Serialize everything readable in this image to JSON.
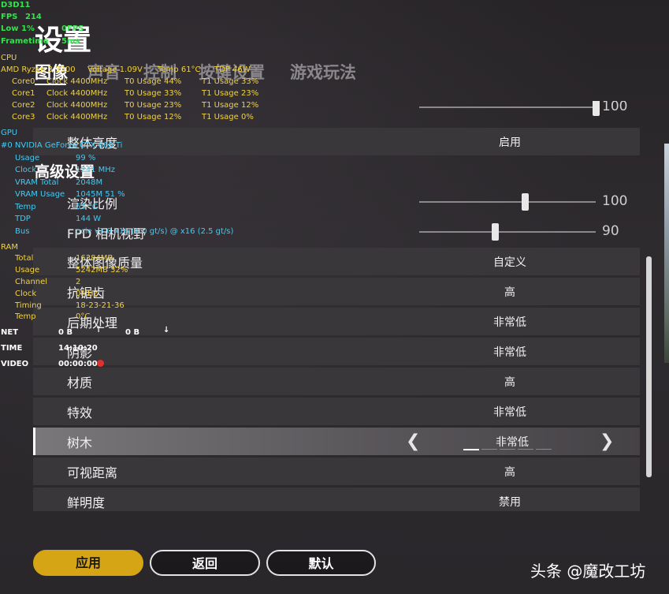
{
  "page": {
    "title": "设置"
  },
  "tabs": [
    {
      "label": "图像",
      "active": true
    },
    {
      "label": "声音"
    },
    {
      "label": "控制"
    },
    {
      "label": "按键设置"
    },
    {
      "label": "游戏玩法"
    }
  ],
  "partial_top_slider": {
    "value": "100"
  },
  "rows_top": [
    {
      "label": "整体亮度",
      "value": "启用"
    }
  ],
  "advanced": {
    "title": "高级设置",
    "sliders": [
      {
        "label": "渲染比例",
        "value": "100",
        "fraction": 0.6
      },
      {
        "label": "FPD 相机视野",
        "value": "90",
        "fraction": 0.43
      }
    ],
    "rows": [
      {
        "label": "整体图像质量",
        "value": "自定义"
      },
      {
        "label": "抗锯齿",
        "value": "高"
      },
      {
        "label": "后期处理",
        "value": "非常低"
      },
      {
        "label": "阴影",
        "value": "非常低"
      },
      {
        "label": "材质",
        "value": "高"
      },
      {
        "label": "特效",
        "value": "非常低"
      },
      {
        "label": "树木",
        "value": "非常低",
        "active": true,
        "level_of_5": 1
      },
      {
        "label": "可视距离",
        "value": "高"
      },
      {
        "label": "鲜明度",
        "value": "禁用"
      }
    ]
  },
  "buttons": {
    "apply": "应用",
    "back": "返回",
    "default": "默认"
  },
  "watermark": "头条 @魔改工坊",
  "colors": {
    "accent": "#d5a516",
    "osd_green": "#36e04e",
    "osd_yellow": "#f3d23b",
    "osd_cyan": "#48c8f0"
  },
  "osd": {
    "api": "D3D11",
    "fps_label": "FPS",
    "fps_value": "214",
    "low_label": "Low 1%",
    "low_value": "0FPS",
    "frametime_label": "Frametime",
    "frametime_value": "5ms",
    "cpu_label": "CPU",
    "cpu_model": "AMD Ryzen 3 3300",
    "cpu_voltage": "Voltage   1.09V",
    "cpu_temp": "Temp   61°C",
    "cpu_tdp": "TDP   46W",
    "cores": [
      {
        "name": "Core0",
        "clock": "Clock   4400MHz",
        "t0": "T0 Usage   44%",
        "t1": "T1 Usage   33%"
      },
      {
        "name": "Core1",
        "clock": "Clock   4400MHz",
        "t0": "T0 Usage   33%",
        "t1": "T1 Usage   23%"
      },
      {
        "name": "Core2",
        "clock": "Clock   4400MHz",
        "t0": "T0 Usage   23%",
        "t1": "T1 Usage   12%"
      },
      {
        "name": "Core3",
        "clock": "Clock   4400MHz",
        "t0": "T0 Usage   12%",
        "t1": "T1 Usage   0%"
      }
    ],
    "gpu_label": "GPU",
    "gpu_model": "#0 NVIDIA GeForce GTX 660 Ti",
    "gpu_stats": [
      {
        "k": "Usage",
        "v": "99 %"
      },
      {
        "k": "Clock",
        "v": "1241 MHz"
      },
      {
        "k": "VRAM Total",
        "v": "2048M"
      },
      {
        "k": "VRAM Usage",
        "v": "1045M      51 %"
      },
      {
        "k": "Temp",
        "v": "63 °C"
      },
      {
        "k": "TDP",
        "v": "144 W"
      },
      {
        "k": "Bus",
        "v": "pcie v3.0 x16 (8.0 gt/s) @ x16 (2.5 gt/s)"
      }
    ],
    "ram_label": "RAM",
    "ram_stats": [
      {
        "k": "Total",
        "v": "16384MB"
      },
      {
        "k": "Usage",
        "v": "5242MB      32%"
      },
      {
        "k": "Channel",
        "v": "2"
      },
      {
        "k": "Clock",
        "v": "0MHz"
      },
      {
        "k": "Timing",
        "v": "18-23-21-36"
      },
      {
        "k": "Temp",
        "v": "0°C"
      }
    ],
    "net_label": "NET",
    "net_up": "0 B",
    "net_up_arrow": "↑",
    "net_down": "0 B",
    "net_down_arrow": "↓",
    "time_label": "TIME",
    "time_value": "14:10:20",
    "video_label": "VIDEO",
    "video_value": "00:00:00"
  }
}
